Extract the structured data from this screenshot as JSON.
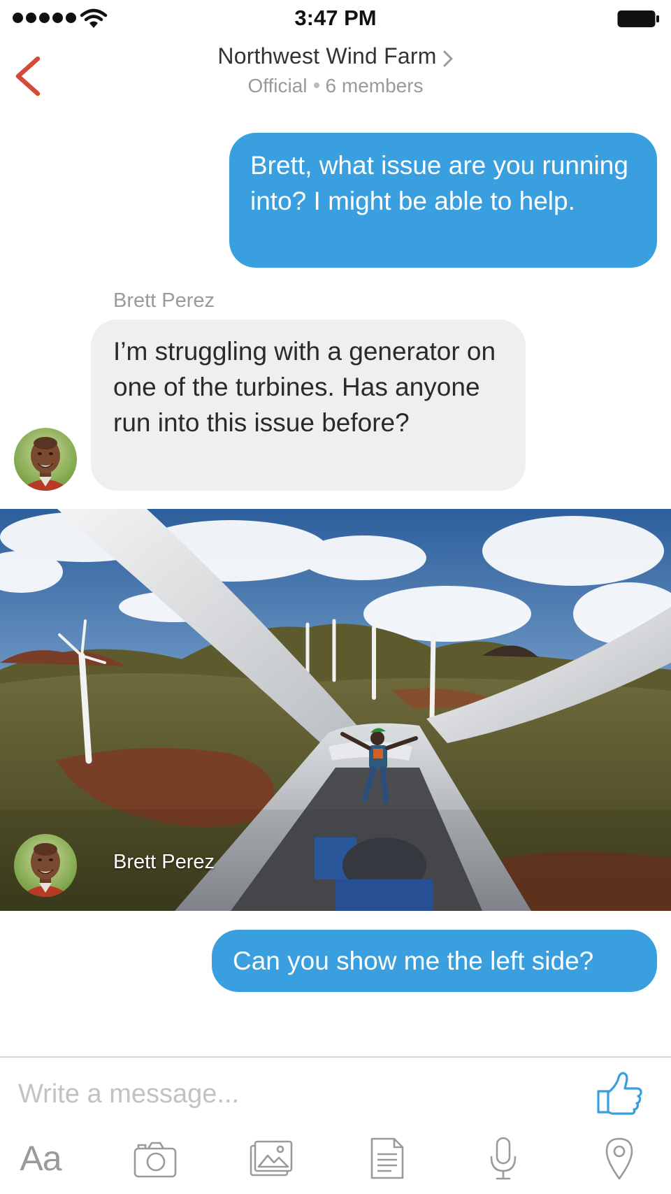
{
  "status_bar": {
    "time": "3:47 PM",
    "signal_icon": "signal-dots-icon",
    "wifi_icon": "wifi-icon",
    "battery_icon": "battery-full-icon"
  },
  "header": {
    "back_icon": "chevron-left-icon",
    "title": "Northwest Wind Farm",
    "subtitle_type": "Official",
    "subtitle_members": "6 members"
  },
  "messages": [
    {
      "direction": "outgoing",
      "text": "Brett, what issue are you running into? I might be able to help."
    },
    {
      "direction": "incoming",
      "sender": "Brett Perez",
      "text": "I’m struggling with a generator on one of the turbines.  Has anyone run into this issue before?"
    },
    {
      "direction": "incoming",
      "sender": "Brett Perez",
      "type": "photo"
    },
    {
      "direction": "outgoing",
      "text": "Can you show me the left side?"
    }
  ],
  "composer": {
    "placeholder": "Write a message...",
    "like_icon": "thumbs-up-icon",
    "toolbar": {
      "text_format_label": "Aa",
      "items": [
        "camera-icon",
        "photo-library-icon",
        "document-icon",
        "microphone-icon",
        "location-pin-icon"
      ]
    }
  },
  "colors": {
    "accent": "#3a9fde",
    "back_arrow": "#d44a36",
    "incoming_bubble": "#efefef",
    "muted_text": "#9a9a9a"
  }
}
